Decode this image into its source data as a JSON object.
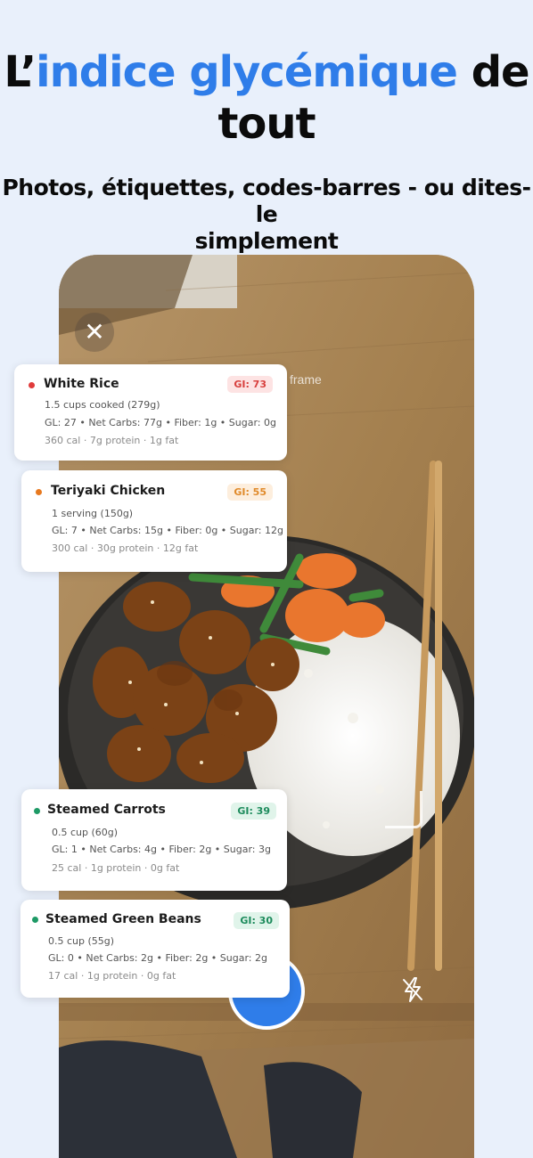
{
  "header": {
    "title_prefix": "L’",
    "title_accent": "indice glycémique",
    "title_suffix_1": " de",
    "title_suffix_2": "tout",
    "subtitle_line1": "Photos, étiquettes, codes-barres - ou dites-le",
    "subtitle_line2": "simplement"
  },
  "camera": {
    "close_icon": "close-icon",
    "frame_label": "frame",
    "flash_icon": "flash-off-icon",
    "accent_color": "#2f7de9"
  },
  "foods": [
    {
      "name": "White Rice",
      "gi": "GI: 73",
      "serving": "1.5 cups cooked (279g)",
      "details": "GL: 27 • Net Carbs: 77g • Fiber: 1g • Sugar: 0g",
      "macros": "360 cal  ·  7g protein  ·  1g fat",
      "dot_color": "#e03b3b",
      "badge_bg": "#fde3e3",
      "badge_color": "#d8403e"
    },
    {
      "name": "Teriyaki Chicken",
      "gi": "GI: 55",
      "serving": "1 serving (150g)",
      "details": "GL: 7 • Net Carbs: 15g • Fiber: 0g • Sugar: 12g",
      "macros": "300 cal  ·  30g protein  ·  12g fat",
      "dot_color": "#e7791f",
      "badge_bg": "#fdeedd",
      "badge_color": "#e08a2a"
    },
    {
      "name": "Steamed Carrots",
      "gi": "GI: 39",
      "serving": "0.5 cup (60g)",
      "details": "GL: 1 • Net Carbs: 4g • Fiber: 2g • Sugar: 3g",
      "macros": "25 cal  ·  1g protein  ·  0g fat",
      "dot_color": "#1e9a66",
      "badge_bg": "#e0f4ea",
      "badge_color": "#1d8b5c"
    },
    {
      "name": "Steamed Green Beans",
      "gi": "GI: 30",
      "serving": "0.5 cup (55g)",
      "details": "GL: 0 • Net Carbs: 2g • Fiber: 2g • Sugar: 2g",
      "macros": "17 cal  ·  1g protein  ·  0g fat",
      "dot_color": "#1e9a66",
      "badge_bg": "#e0f4ea",
      "badge_color": "#1d8b5c"
    }
  ]
}
